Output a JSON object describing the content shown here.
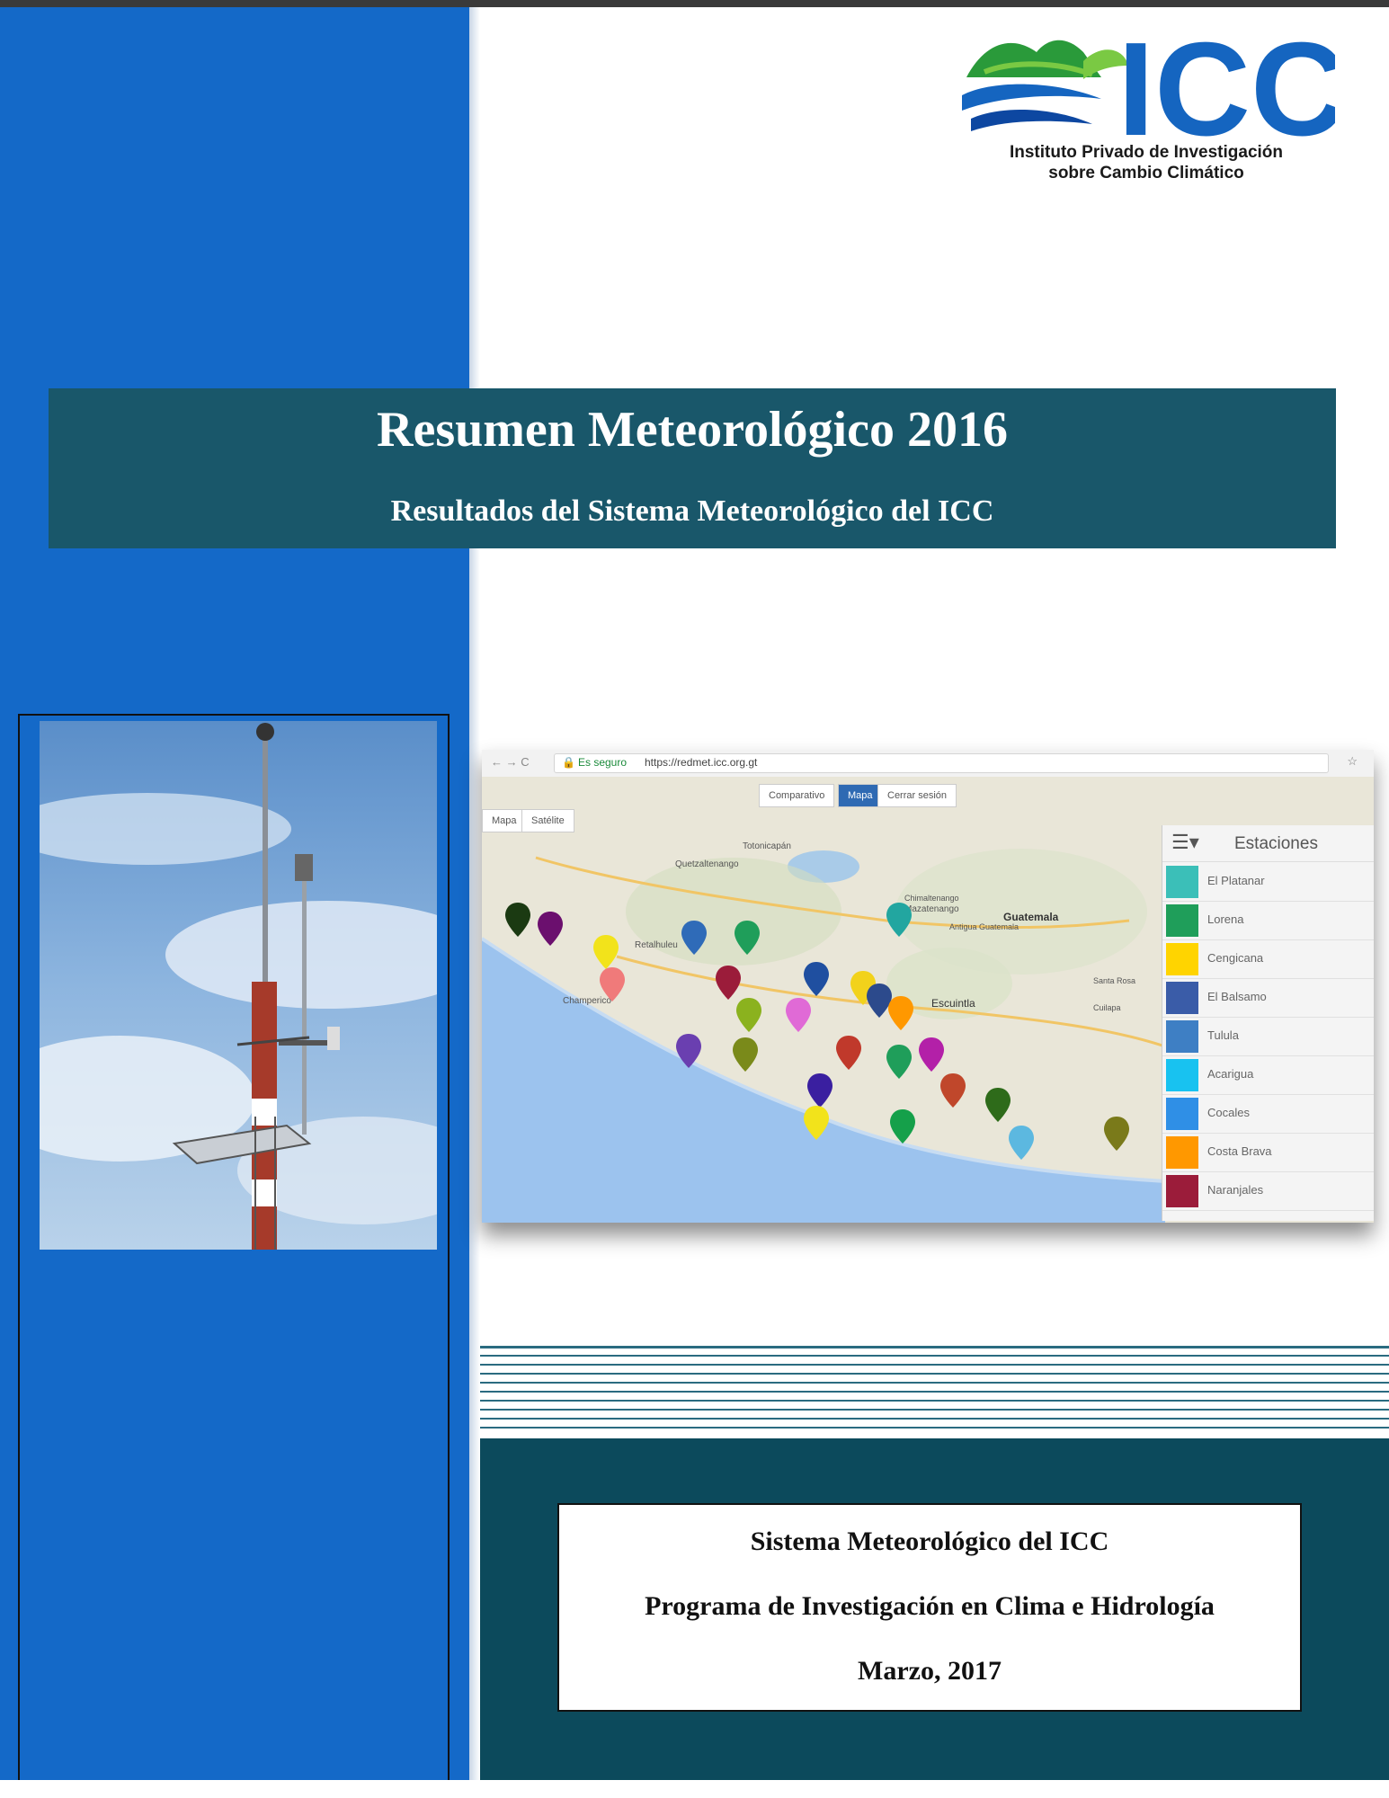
{
  "logo": {
    "brand": "ICC",
    "line1": "Instituto Privado de Investigación",
    "line2": "sobre Cambio Climático",
    "colors": {
      "green": "#2a9a3a",
      "blue": "#1565c0",
      "leaf": "#7ac943"
    }
  },
  "title": {
    "main": "Resumen Meteorológico 2016",
    "sub": "Resultados del Sistema Meteorológico del ICC"
  },
  "screenshot": {
    "secure_label": "Es seguro",
    "url": "https://redmet.icc.org.gt",
    "tabs": [
      "Mapa",
      "Satélite"
    ],
    "buttons": [
      "Comparativo",
      "Mapa",
      "Cerrar sesión"
    ],
    "legend_title": "Estaciones",
    "stations": [
      {
        "name": "El Platanar",
        "color": "#3bbfb8"
      },
      {
        "name": "Lorena",
        "color": "#1f9e5a"
      },
      {
        "name": "Cengicana",
        "color": "#ffd400"
      },
      {
        "name": "El Balsamo",
        "color": "#3a5ca8"
      },
      {
        "name": "Tulula",
        "color": "#3e7fc4"
      },
      {
        "name": "Acarigua",
        "color": "#18c2f0"
      },
      {
        "name": "Cocales",
        "color": "#2f8fe6"
      },
      {
        "name": "Costa Brava",
        "color": "#ff9800"
      },
      {
        "name": "Naranjales",
        "color": "#9b1c3a"
      }
    ],
    "map_places": [
      "Quetzaltenango",
      "Totonicapán",
      "Retalhuleu",
      "Mazatenango",
      "Escuintla",
      "Guatemala",
      "Champerico",
      "Antigua Guatemala",
      "Chimaltenango",
      "Santa Rosa",
      "Cuilapa"
    ]
  },
  "footer_box": {
    "line1": "Sistema Meteorológico del ICC",
    "line2": "Programa de Investigación en Clima e Hidrología",
    "line3": "Marzo, 2017"
  },
  "colors": {
    "left_column": "#1469c8",
    "title_band": "#19576a",
    "bottom_panel": "#0c4a5c"
  }
}
